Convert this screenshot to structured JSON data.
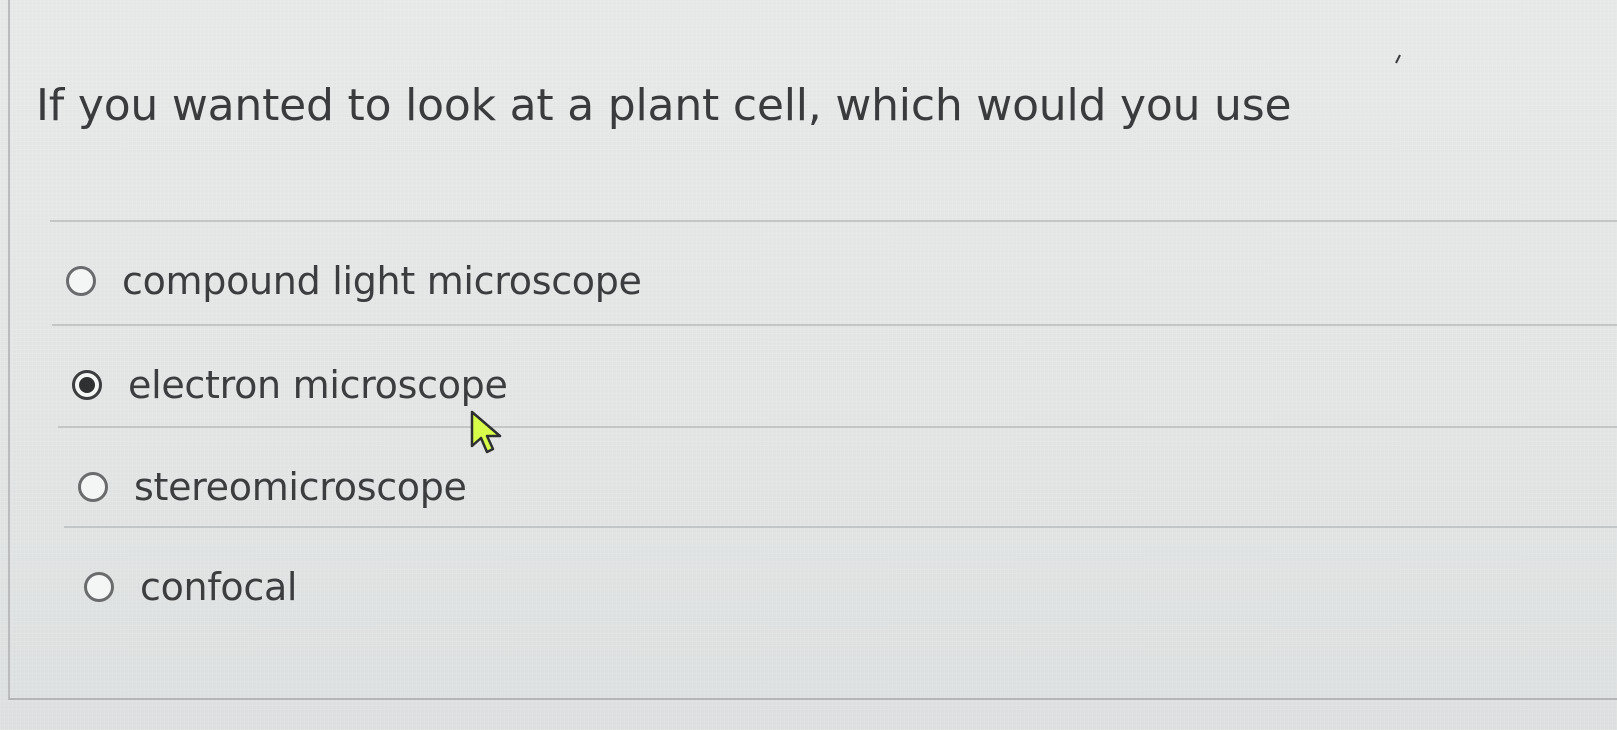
{
  "question": {
    "text": "If you wanted to look at a plant cell, which would you use"
  },
  "options": [
    {
      "label": "compound light microscope",
      "selected": false
    },
    {
      "label": "electron microscope",
      "selected": true
    },
    {
      "label": "stereomicroscope",
      "selected": false
    },
    {
      "label": "confocal",
      "selected": false
    }
  ],
  "colors": {
    "background": "#e3e4e4",
    "text": "#3b3c3d",
    "divider": "#c3c6c7",
    "cursor_fill": "#d8ff4a"
  },
  "icons": {
    "pointer": "mouse-pointer-icon"
  }
}
